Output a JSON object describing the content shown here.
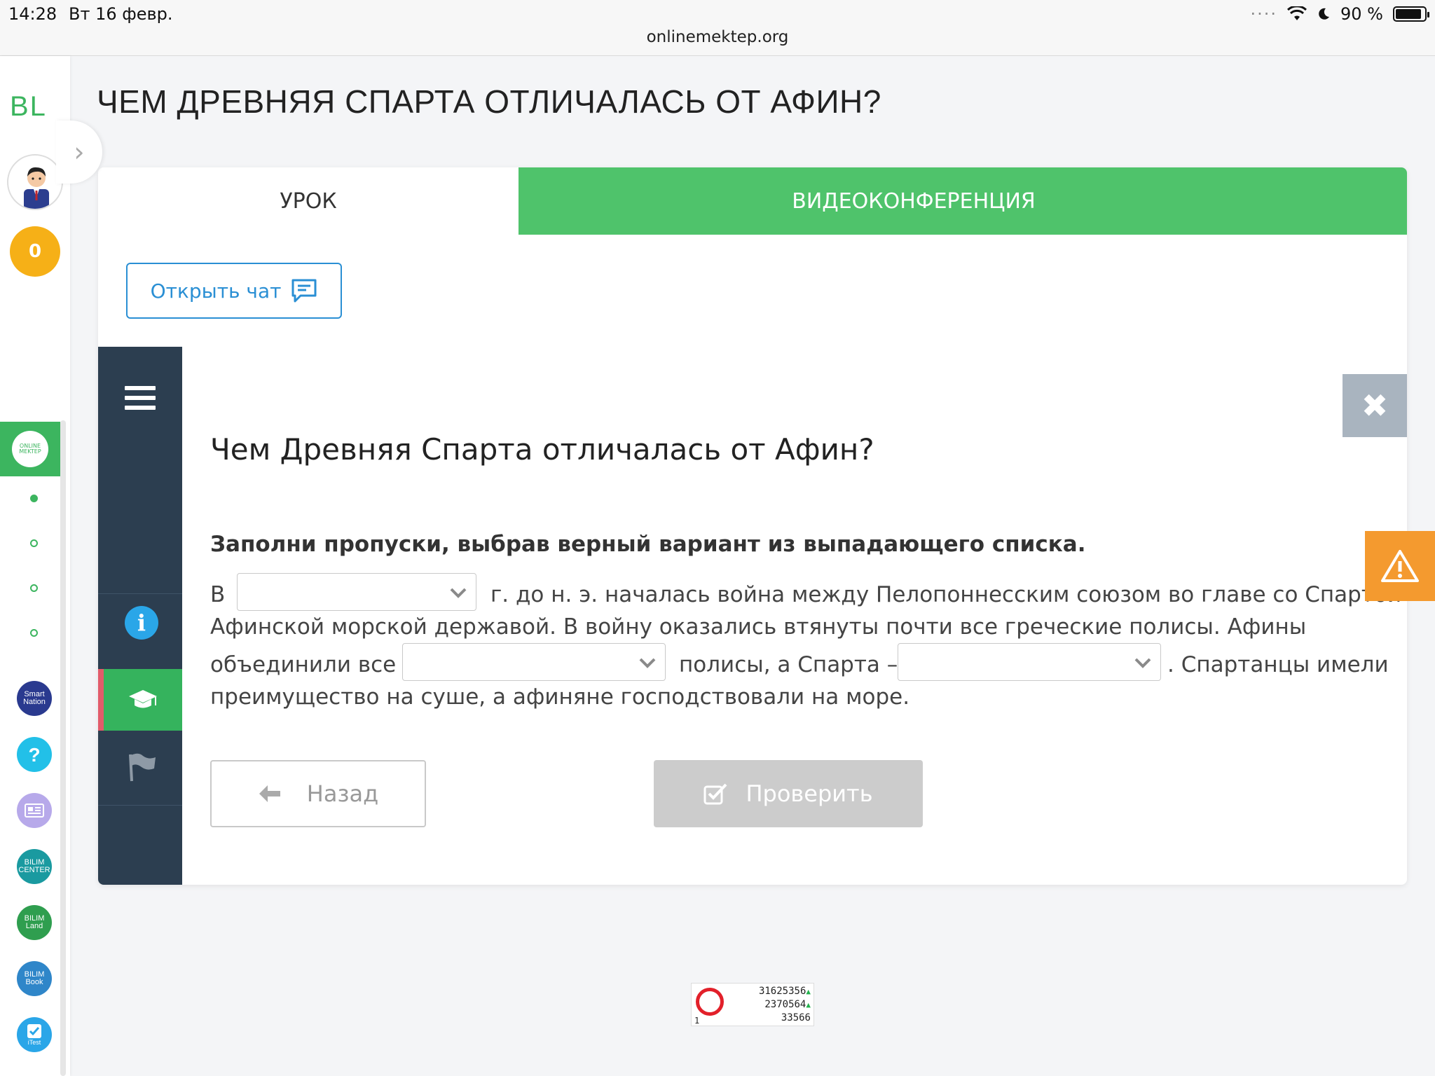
{
  "status_bar": {
    "time": "14:28",
    "date": "Вт 16 февр.",
    "url": "onlinemektep.org",
    "battery": "90 %"
  },
  "sidebar": {
    "logo": "BL",
    "coins": "0",
    "online_mektep_label": "ONLINE MEKTEP",
    "apps": [
      {
        "label": "Smart Nation",
        "color": "#2a3a8f"
      },
      {
        "label": "?",
        "color": "#22c0e8"
      },
      {
        "label": "",
        "color": "#b7a9ea"
      },
      {
        "label": "BILIM CENTER",
        "color": "#1a9aa0"
      },
      {
        "label": "BILIM Land",
        "color": "#2f9e4f"
      },
      {
        "label": "BILIM Book",
        "color": "#2f86c9"
      },
      {
        "label": "iTest",
        "color": "#2aa6e8"
      }
    ]
  },
  "page_title": "ЧЕМ ДРЕВНЯЯ СПАРТА ОТЛИЧАЛАСЬ ОТ АФИН?",
  "tabs": {
    "lesson": "УРОК",
    "video": "ВИДЕОКОНФЕРЕНЦИЯ"
  },
  "chat_button": "Открыть чат",
  "question": {
    "title": "Чем Древняя Спарта отличалась от Афин?",
    "instruction": "Заполни пропуски, выбрав верный вариант из выпадающего списка.",
    "line1_prefix": "В",
    "line1_suffix": "г. до н. э. началась война между Пелопоннесским союзом во главе со Спартой и",
    "line2": "Афинской морской державой. В войну оказались втянуты почти все греческие полисы. Афины",
    "line3_prefix": "объединили все",
    "line3_middle": "полисы, а Спарта –",
    "line3_suffix": ". Спартанцы имели",
    "line4": "преимущество на суше, а афиняне господствовали на море.",
    "select1_value": "",
    "select2_value": "",
    "select3_value": ""
  },
  "buttons": {
    "back": "Назад",
    "check": "Проверить"
  },
  "counter": {
    "line1": "31625356",
    "line2": "2370564",
    "line3": "33566",
    "corner": "1"
  },
  "colors": {
    "green": "#4fc36b",
    "dark_panel": "#2c3e50",
    "warning": "#f49a2f",
    "link_blue": "#2a8fd4"
  }
}
